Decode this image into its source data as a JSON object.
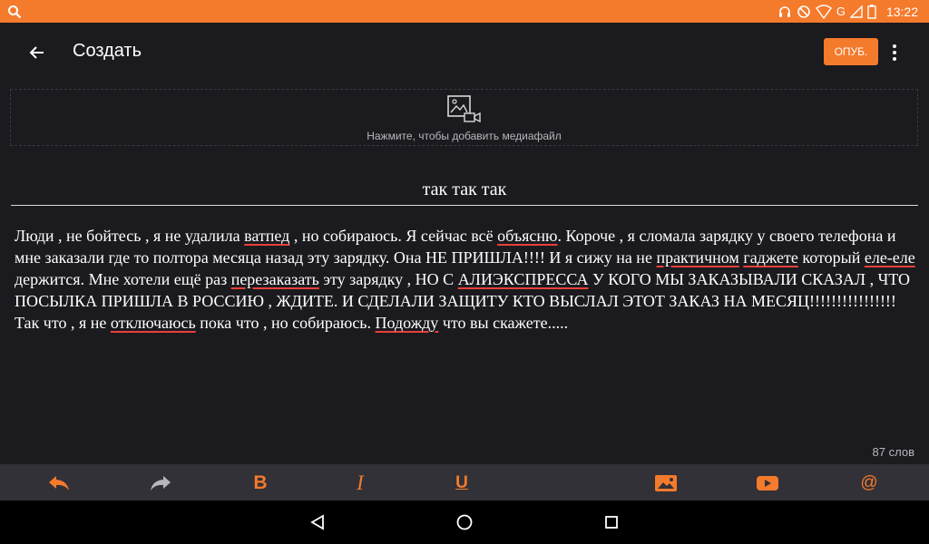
{
  "status_bar": {
    "time": "13:22",
    "network": "G",
    "icons": [
      "search-icon",
      "headset-icon",
      "do-not-disturb-icon",
      "wifi-icon",
      "signal-icon",
      "battery-icon"
    ],
    "background": "#f47a2c"
  },
  "app_bar": {
    "title": "Создать",
    "publish_label": "ОПУБ.",
    "accent": "#f47a2c"
  },
  "media": {
    "hint": "Нажмите, чтобы добавить медиафайл"
  },
  "post": {
    "title": "так так так",
    "body": [
      {
        "t": "Люди , не бойтесь , я не удалила "
      },
      {
        "t": "ватпед",
        "s": true
      },
      {
        "t": " , но собираюсь. Я сейчас всё "
      },
      {
        "t": "объясню",
        "s": true
      },
      {
        "t": ". Короче , я сломала зарядку у своего телефона и мне заказали где то полтора месяца назад эту зарядку. Она НЕ ПРИШЛА!!!! И я сижу на не "
      },
      {
        "t": "практичном",
        "s": true
      },
      {
        "t": " "
      },
      {
        "t": "гаджете",
        "s": true
      },
      {
        "t": " который "
      },
      {
        "t": "еле-еле",
        "s": true
      },
      {
        "t": " держится. Мне хотели ещё раз "
      },
      {
        "t": "перезаказать",
        "s": true
      },
      {
        "t": " эту зарядку , НО С "
      },
      {
        "t": "АЛИЭКСПРЕССА",
        "s": true
      },
      {
        "t": " У КОГО МЫ ЗАКАЗЫВАЛИ СКАЗАЛ , ЧТО ПОСЫЛКА ПРИШЛА В РОССИЮ , ЖДИТЕ. И СДЕЛАЛИ ЗАЩИТУ КТО ВЫСЛАЛ ЭТОТ ЗАКАЗ НА МЕСЯЦ!!!!!!!!!!!!!!!! Так что , я не "
      },
      {
        "t": "отключаюсь",
        "s": true
      },
      {
        "t": " пока что  , но собираюсь. "
      },
      {
        "t": "Подожду",
        "s": true
      },
      {
        "t": " что вы скажете....."
      }
    ],
    "word_count": "87 слов"
  },
  "format_toolbar": {
    "bold": "B",
    "italic": "I",
    "underline": "U",
    "mention": "@",
    "icons": [
      "undo-icon",
      "redo-icon",
      "bold-icon",
      "italic-icon",
      "underline-icon",
      "insert-image-icon",
      "insert-video-icon",
      "mention-icon"
    ]
  },
  "nav_bar": {
    "icons": [
      "back-nav-icon",
      "home-nav-icon",
      "recents-nav-icon"
    ]
  }
}
